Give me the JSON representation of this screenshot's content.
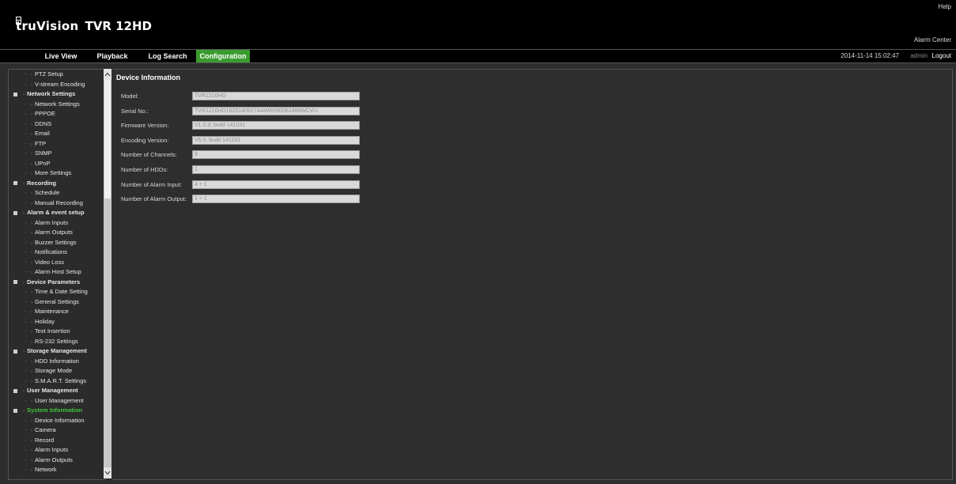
{
  "header": {
    "brand_name": "truVision",
    "brand_model": "TVR 12HD",
    "help_label": "Help",
    "alarm_center_label": "Alarm Center"
  },
  "navbar": {
    "tabs": [
      {
        "label": "Live View"
      },
      {
        "label": "Playback"
      },
      {
        "label": "Log Search"
      },
      {
        "label": "Configuration",
        "active": true
      }
    ],
    "datetime": "2014-11-14 15:02:47",
    "user": "admin",
    "logout_label": "Logout"
  },
  "sidebar": {
    "items": [
      {
        "label": "PTZ Setup",
        "type": "child"
      },
      {
        "label": "V-stream Encoding",
        "type": "child"
      },
      {
        "label": "Network Settings",
        "type": "section"
      },
      {
        "label": "Network Settings",
        "type": "child"
      },
      {
        "label": "PPPOE",
        "type": "child"
      },
      {
        "label": "DDNS",
        "type": "child"
      },
      {
        "label": "Email",
        "type": "child"
      },
      {
        "label": "FTP",
        "type": "child"
      },
      {
        "label": "SNMP",
        "type": "child"
      },
      {
        "label": "UPnP",
        "type": "child"
      },
      {
        "label": "More Settings",
        "type": "child"
      },
      {
        "label": "Recording",
        "type": "section"
      },
      {
        "label": "Schedule",
        "type": "child"
      },
      {
        "label": "Manual Recording",
        "type": "child"
      },
      {
        "label": "Alarm & event setup",
        "type": "section"
      },
      {
        "label": "Alarm Inputs",
        "type": "child"
      },
      {
        "label": "Alarm Outputs",
        "type": "child"
      },
      {
        "label": "Buzzer Settings",
        "type": "child"
      },
      {
        "label": "Notifications",
        "type": "child"
      },
      {
        "label": "Video Loss",
        "type": "child"
      },
      {
        "label": "Alarm Host Setup",
        "type": "child"
      },
      {
        "label": "Device Parameters",
        "type": "section"
      },
      {
        "label": "Time & Date Setting",
        "type": "child"
      },
      {
        "label": "General Settings",
        "type": "child"
      },
      {
        "label": "Maintenance",
        "type": "child"
      },
      {
        "label": "Holiday",
        "type": "child"
      },
      {
        "label": "Text Insertion",
        "type": "child"
      },
      {
        "label": "RS-232 Settings",
        "type": "child"
      },
      {
        "label": "Storage Management",
        "type": "section"
      },
      {
        "label": "HDD Information",
        "type": "child"
      },
      {
        "label": "Storage Mode",
        "type": "child"
      },
      {
        "label": "S.M.A.R.T. Settings",
        "type": "child"
      },
      {
        "label": "User Management",
        "type": "section"
      },
      {
        "label": "User Management",
        "type": "child"
      },
      {
        "label": "System Information",
        "type": "section",
        "active": true
      },
      {
        "label": "Device Information",
        "type": "child"
      },
      {
        "label": "Camera",
        "type": "child"
      },
      {
        "label": "Record",
        "type": "child"
      },
      {
        "label": "Alarm Inputs",
        "type": "child"
      },
      {
        "label": "Alarm Outputs",
        "type": "child"
      },
      {
        "label": "Network",
        "type": "child"
      }
    ]
  },
  "content": {
    "title": "Device Information",
    "rows": [
      {
        "label": "Model:",
        "value": "TVR1216HD"
      },
      {
        "label": "Serial No.:",
        "value": "TVR1216HD1620140927AAWR090082486WCVU"
      },
      {
        "label": "Firmware Version:",
        "value": "V1.0.d, build 141031"
      },
      {
        "label": "Encoding Version:",
        "value": "V5.0, build 141031"
      },
      {
        "label": "Number of Channels:",
        "value": "9"
      },
      {
        "label": "Number of HDDs:",
        "value": "1"
      },
      {
        "label": "Number of Alarm Input:",
        "value": "4 + 1"
      },
      {
        "label": "Number of Alarm Output:",
        "value": "1 + 1"
      }
    ]
  },
  "colors": {
    "accent": "#3a9c2f",
    "active_text": "#3fc83a",
    "background": "#2e2e2e",
    "header": "#000000"
  }
}
